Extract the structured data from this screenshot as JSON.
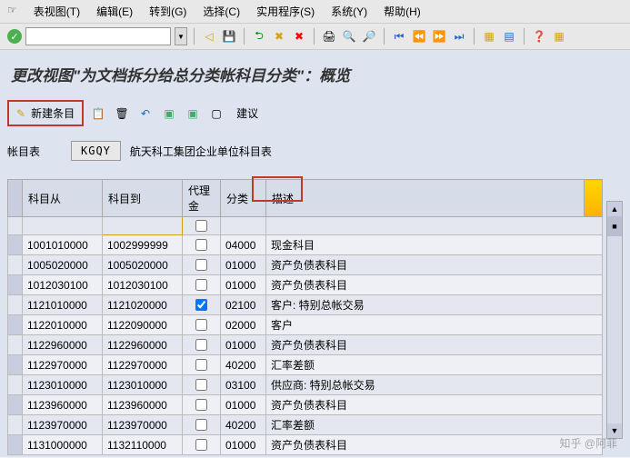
{
  "menu": {
    "icon": "☞",
    "items": [
      "表视图(T)",
      "编辑(E)",
      "转到(G)",
      "选择(C)",
      "实用程序(S)",
      "系统(Y)",
      "帮助(H)"
    ]
  },
  "toolbar_icons": {
    "check": "✓",
    "back": "◁",
    "save": "💾",
    "exit1": "⮌",
    "exit2": "✖",
    "cancel": "✖",
    "print": "🖨",
    "find": "🔍",
    "findn": "🔎",
    "first": "⏮",
    "prev": "⏪",
    "next": "⏩",
    "last": "⏭",
    "grid1": "▦",
    "grid2": "▤",
    "help": "❓"
  },
  "page_title": "更改视图\"为文档拆分给总分类帐科目分类\"：概览",
  "actions": {
    "new_icon": "✎",
    "new_label": "新建条目",
    "copy": "📋",
    "delete": "🗑",
    "undo": "↶",
    "sel1": "▣",
    "sel2": "▣",
    "sel3": "▢",
    "suggest": "建议"
  },
  "field": {
    "label": "帐目表",
    "value": "KGQY",
    "desc": "航天科工集团企业单位科目表"
  },
  "columns": {
    "from": "科目从",
    "to": "科目到",
    "comm": "代理金",
    "cat": "分类",
    "desc": "描述"
  },
  "rows": [
    {
      "from": "",
      "to": "",
      "comm": false,
      "cat": "",
      "desc": "",
      "edit": true
    },
    {
      "from": "1001010000",
      "to": "1002999999",
      "comm": false,
      "cat": "04000",
      "desc": "现金科目"
    },
    {
      "from": "1005020000",
      "to": "1005020000",
      "comm": false,
      "cat": "01000",
      "desc": "资产负债表科目"
    },
    {
      "from": "1012030100",
      "to": "1012030100",
      "comm": false,
      "cat": "01000",
      "desc": "资产负债表科目"
    },
    {
      "from": "1121010000",
      "to": "1121020000",
      "comm": true,
      "cat": "02100",
      "desc": "客户: 特别总帐交易"
    },
    {
      "from": "1122010000",
      "to": "1122090000",
      "comm": false,
      "cat": "02000",
      "desc": "客户"
    },
    {
      "from": "1122960000",
      "to": "1122960000",
      "comm": false,
      "cat": "01000",
      "desc": "资产负债表科目"
    },
    {
      "from": "1122970000",
      "to": "1122970000",
      "comm": false,
      "cat": "40200",
      "desc": "汇率差额"
    },
    {
      "from": "1123010000",
      "to": "1123010000",
      "comm": false,
      "cat": "03100",
      "desc": "供应商: 特别总帐交易"
    },
    {
      "from": "1123960000",
      "to": "1123960000",
      "comm": false,
      "cat": "01000",
      "desc": "资产负债表科目"
    },
    {
      "from": "1123970000",
      "to": "1123970000",
      "comm": false,
      "cat": "40200",
      "desc": "汇率差额"
    },
    {
      "from": "1131000000",
      "to": "1132110000",
      "comm": false,
      "cat": "01000",
      "desc": "资产负债表科目"
    }
  ],
  "watermark": "知乎 @阿菲"
}
